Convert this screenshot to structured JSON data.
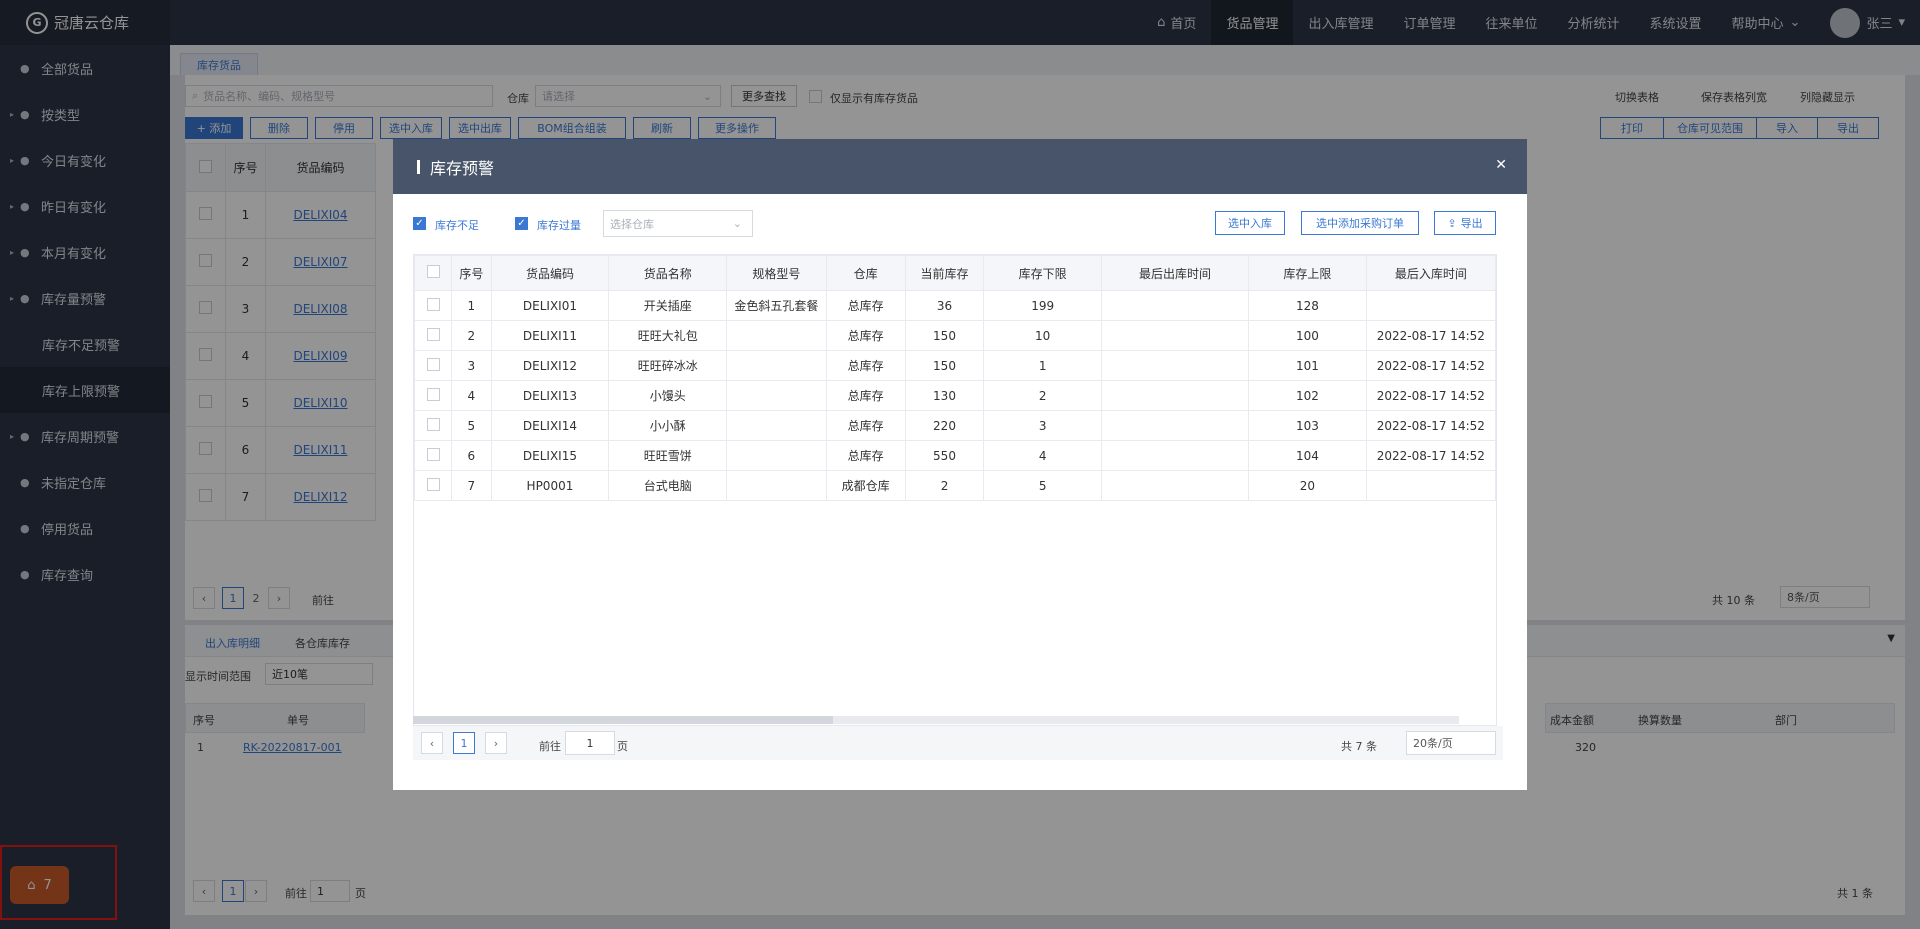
{
  "app": {
    "logo_text": "冠唐云仓库",
    "fav_count": "7"
  },
  "sidebar": {
    "items": [
      {
        "label": "全部货品",
        "icon": "refresh-icon"
      },
      {
        "label": "按类型",
        "icon": "grid-icon"
      },
      {
        "label": "今日有变化",
        "icon": "sun-icon"
      },
      {
        "label": "昨日有变化",
        "icon": "moon-icon"
      },
      {
        "label": "本月有变化",
        "icon": "calendar-icon"
      },
      {
        "label": "库存量预警",
        "icon": "info-icon"
      }
    ],
    "sub_items": [
      "库存不足预警",
      "库存上限预警"
    ],
    "items2": [
      {
        "label": "库存周期预警",
        "icon": "alarm-icon"
      },
      {
        "label": "未指定仓库",
        "icon": "question-icon"
      },
      {
        "label": "停用货品",
        "icon": "stop-icon"
      },
      {
        "label": "库存查询",
        "icon": "list-icon"
      }
    ]
  },
  "topnav": {
    "items": [
      "首页",
      "货品管理",
      "出入库管理",
      "订单管理",
      "往来单位",
      "分析统计",
      "系统设置",
      "帮助中心"
    ],
    "user": "张三"
  },
  "tab": {
    "label": "库存货品"
  },
  "toolbar": {
    "search_placeholder": "货品名称、编码、规格型号",
    "warehouse_label": "仓库",
    "warehouse_placeholder": "请选择",
    "more_search": "更多查找",
    "only_stock": "仅显示有库存货品",
    "switch_table": "切换表格",
    "save_width": "保存表格列宽",
    "show_hide": "列隐藏显示",
    "add": "+ 添加",
    "delete": "删除",
    "disable": "停用",
    "sel_in": "选中入库",
    "sel_out": "选中出库",
    "bom": "BOM组合组装",
    "refresh": "刷新",
    "more_ops": "更多操作",
    "print": "打印",
    "wh_scope": "仓库可见范围",
    "import": "导入",
    "export": "导出"
  },
  "bg_table": {
    "headers": [
      "序号",
      "货品编码"
    ],
    "rows": [
      {
        "no": "1",
        "code": "DELIXI04"
      },
      {
        "no": "2",
        "code": "DELIXI07"
      },
      {
        "no": "3",
        "code": "DELIXI08"
      },
      {
        "no": "4",
        "code": "DELIXI09"
      },
      {
        "no": "5",
        "code": "DELIXI10"
      },
      {
        "no": "6",
        "code": "DELIXI11"
      },
      {
        "no": "7",
        "code": "DELIXI12"
      }
    ],
    "goto": "前往",
    "total": "共 10 条",
    "page_size": "8条/页"
  },
  "bottom_panel": {
    "tabs": [
      "出入库明细",
      "各仓库库存"
    ],
    "range_label": "显示时间范围",
    "range_value": "近10笔",
    "headers": [
      "序号",
      "单号"
    ],
    "right_headers": [
      "成本金额",
      "换算数量",
      "部门"
    ],
    "row": {
      "no": "1",
      "order": "RK-20220817-001",
      "amount": "320"
    },
    "goto": "前往",
    "page_unit": "页",
    "total": "共 1 条"
  },
  "modal": {
    "title": "库存预警",
    "filter_low": "库存不足",
    "filter_over": "库存过量",
    "warehouse_placeholder": "选择仓库",
    "btn_in": "选中入库",
    "btn_po": "选中添加采购订单",
    "btn_export": "导出",
    "headers": [
      "序号",
      "货品编码",
      "货品名称",
      "规格型号",
      "仓库",
      "当前库存",
      "库存下限",
      "最后出库时间",
      "库存上限",
      "最后入库时间"
    ],
    "rows": [
      {
        "no": "1",
        "code": "DELIXI01",
        "name": "开关插座",
        "spec": "金色斜五孔套餐",
        "wh": "总库存",
        "stock": "36",
        "min": "199",
        "out": "",
        "max": "128",
        "in": ""
      },
      {
        "no": "2",
        "code": "DELIXI11",
        "name": "旺旺大礼包",
        "spec": "",
        "wh": "总库存",
        "stock": "150",
        "min": "10",
        "out": "",
        "max": "100",
        "in": "2022-08-17 14:52"
      },
      {
        "no": "3",
        "code": "DELIXI12",
        "name": "旺旺碎冰冰",
        "spec": "",
        "wh": "总库存",
        "stock": "150",
        "min": "1",
        "out": "",
        "max": "101",
        "in": "2022-08-17 14:52"
      },
      {
        "no": "4",
        "code": "DELIXI13",
        "name": "小馒头",
        "spec": "",
        "wh": "总库存",
        "stock": "130",
        "min": "2",
        "out": "",
        "max": "102",
        "in": "2022-08-17 14:52"
      },
      {
        "no": "5",
        "code": "DELIXI14",
        "name": "小小酥",
        "spec": "",
        "wh": "总库存",
        "stock": "220",
        "min": "3",
        "out": "",
        "max": "103",
        "in": "2022-08-17 14:52"
      },
      {
        "no": "6",
        "code": "DELIXI15",
        "name": "旺旺雪饼",
        "spec": "",
        "wh": "总库存",
        "stock": "550",
        "min": "4",
        "out": "",
        "max": "104",
        "in": "2022-08-17 14:52"
      },
      {
        "no": "7",
        "code": "HP0001",
        "name": "台式电脑",
        "spec": "",
        "wh": "成都仓库",
        "stock": "2",
        "min": "5",
        "out": "",
        "max": "20",
        "in": ""
      }
    ],
    "page": "1",
    "goto": "前往",
    "page_unit": "页",
    "goto_value": "1",
    "total": "共 7 条",
    "page_size": "20条/页"
  }
}
